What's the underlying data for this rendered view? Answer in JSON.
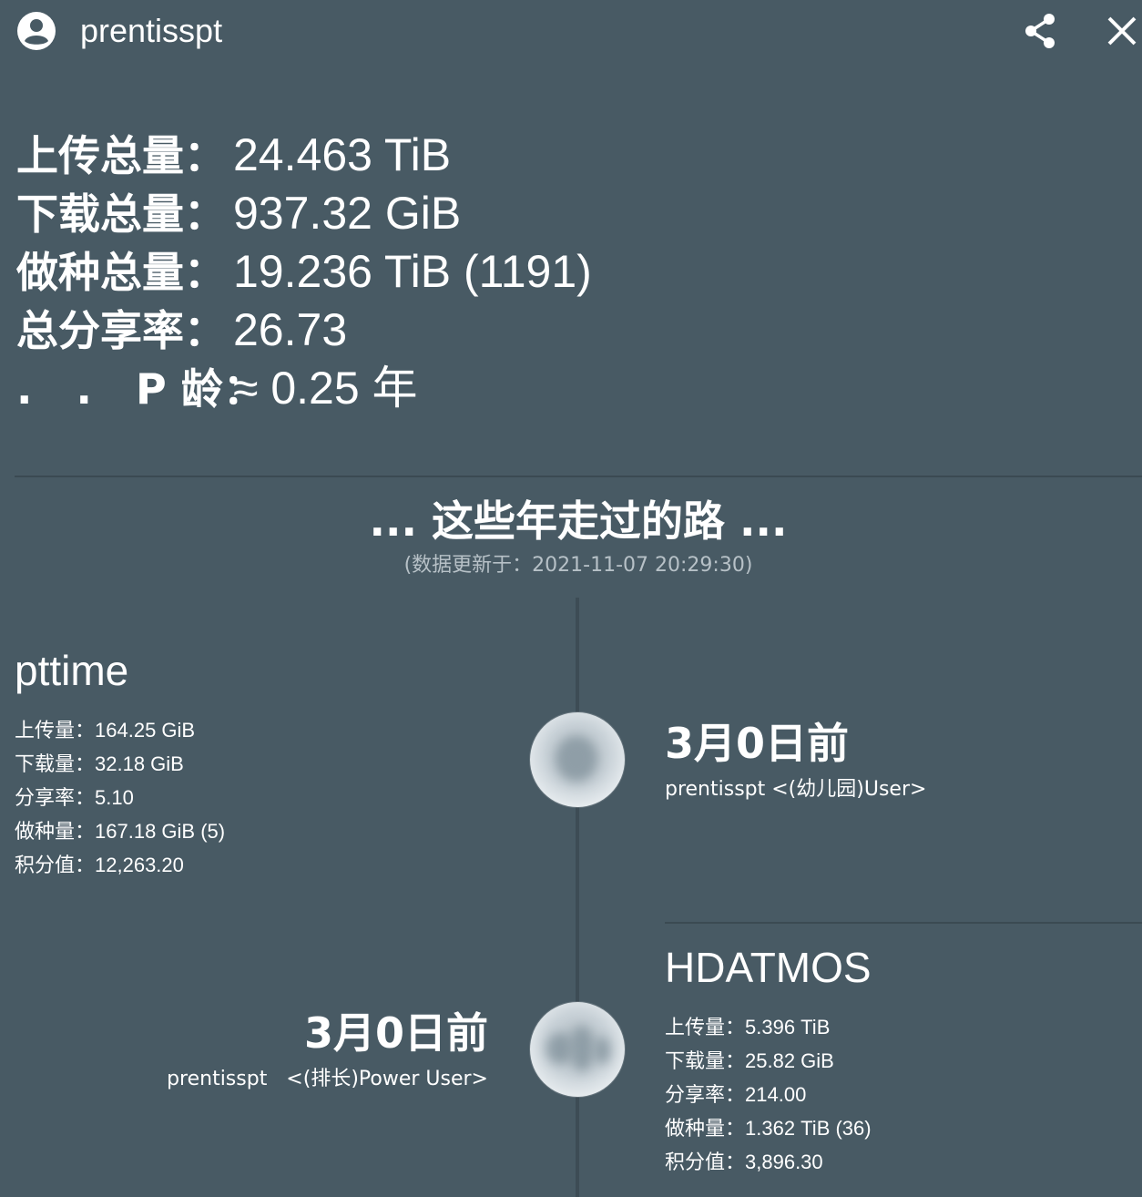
{
  "header": {
    "username": "prentisspt",
    "avatar_icon": "account-circle-icon",
    "share_icon": "share-icon",
    "close_icon": "close-icon"
  },
  "summary": {
    "upload_label": "上传总量：",
    "upload_value": "24.463 TiB",
    "download_label": "下载总量：",
    "download_value": "937.32 GiB",
    "seeding_label": "做种总量：",
    "seeding_value": "19.236 TiB (1191)",
    "ratio_label": "总分享率：",
    "ratio_value": "26.73",
    "age_label": ".   .   P 龄：",
    "age_value": "≈ 0.25 年"
  },
  "journey": {
    "title": "... 这些年走过的路 ...",
    "updated": "(数据更新于：2021-11-07 20:29:30)"
  },
  "sites": [
    {
      "name": "pttime",
      "stats": [
        {
          "label": "上传量：",
          "value": "164.25 GiB"
        },
        {
          "label": "下载量：",
          "value": "32.18 GiB"
        },
        {
          "label": "分享率：",
          "value": "5.10"
        },
        {
          "label": "做种量：",
          "value": "167.18 GiB (5)"
        },
        {
          "label": "积分值：",
          "value": "12,263.20"
        }
      ],
      "event_date": "3月0日前",
      "event_desc": "prentisspt   <(幼儿园)User>"
    },
    {
      "name": "HDATMOS",
      "stats": [
        {
          "label": "上传量：",
          "value": "5.396 TiB"
        },
        {
          "label": "下载量：",
          "value": "25.82 GiB"
        },
        {
          "label": "分享率：",
          "value": "214.00"
        },
        {
          "label": "做种量：",
          "value": "1.362 TiB (36)"
        },
        {
          "label": "积分值：",
          "value": "3,896.30"
        }
      ],
      "event_date": "3月0日前",
      "event_desc": "prentisspt   <(排长)Power User>"
    }
  ]
}
